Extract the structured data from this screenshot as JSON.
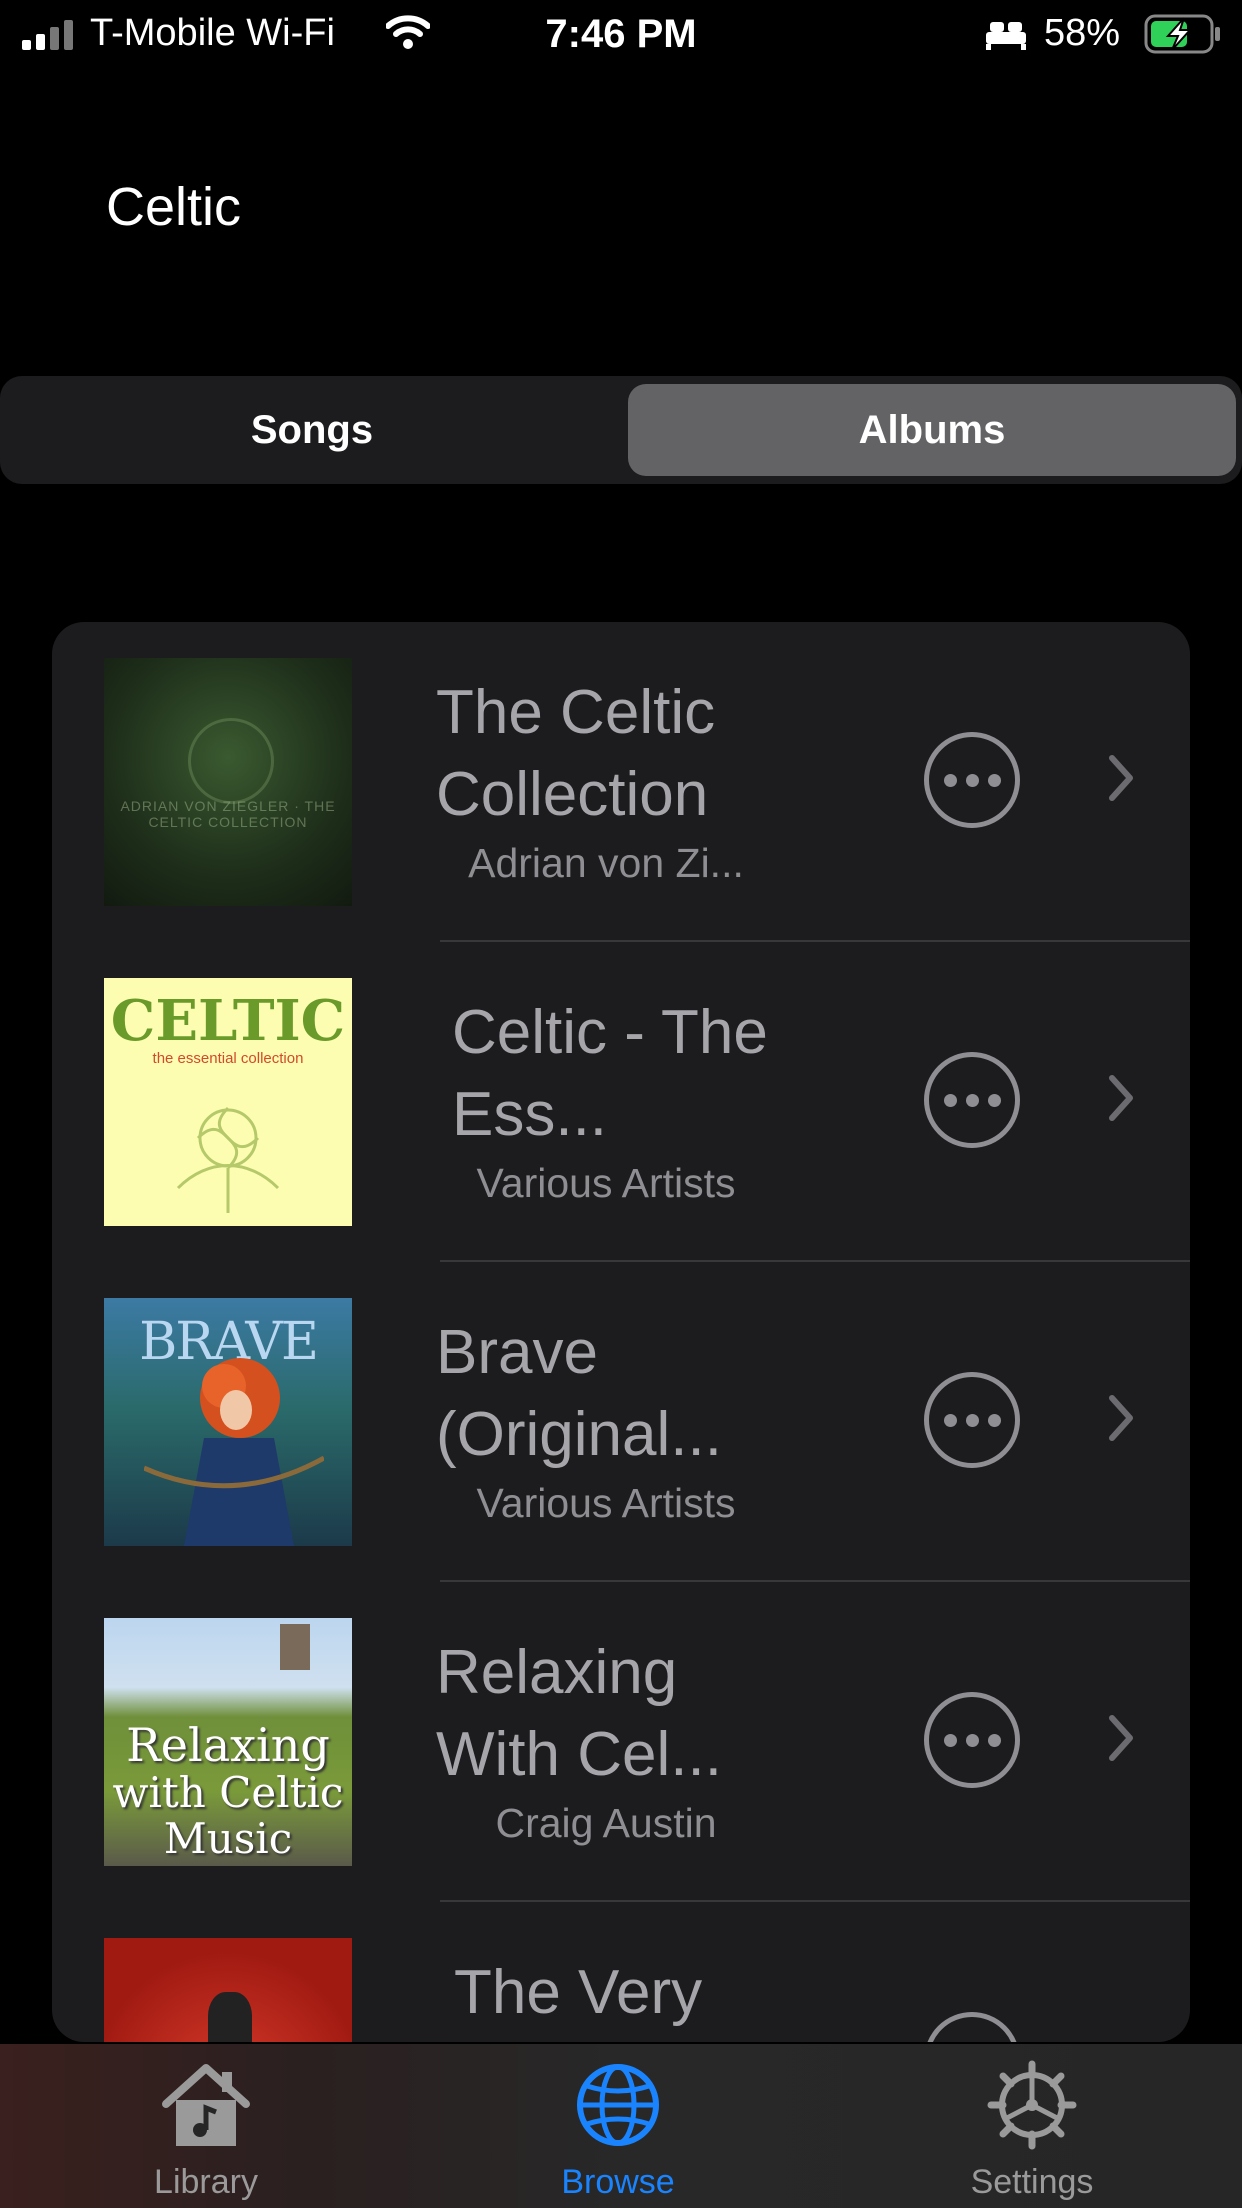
{
  "status_bar": {
    "carrier": "T-Mobile Wi-Fi",
    "time": "7:46 PM",
    "battery_percent": "58%"
  },
  "page": {
    "title": "Celtic"
  },
  "segmented_control": {
    "items": [
      "Songs",
      "Albums"
    ],
    "selected": "Albums"
  },
  "albums": [
    {
      "title": "The Celtic Collection",
      "artist": "Adrian von Zi...",
      "art_text": "ADRIAN VON ZIEGLER · THE CELTIC COLLECTION"
    },
    {
      "title": "Celtic - The Ess...",
      "artist": "Various Artists",
      "art_text": "CELTIC",
      "art_subtext": "the essential collection"
    },
    {
      "title": "Brave (Original...",
      "artist": "Various Artists",
      "art_text": "BRAVE"
    },
    {
      "title": "Relaxing With Cel...",
      "artist": "Craig Austin",
      "art_text": [
        "Relaxing",
        "with Celtic",
        "Music"
      ]
    },
    {
      "title": "The Very",
      "artist": "",
      "art_text": ""
    }
  ],
  "tab_bar": {
    "items": [
      {
        "label": "Library",
        "icon": "house-music-icon"
      },
      {
        "label": "Browse",
        "icon": "globe-icon"
      },
      {
        "label": "Settings",
        "icon": "gear-icon"
      }
    ],
    "selected": "Browse"
  },
  "colors": {
    "accent": "#1a84ff",
    "background": "#000000",
    "card": "#1c1c1e"
  }
}
